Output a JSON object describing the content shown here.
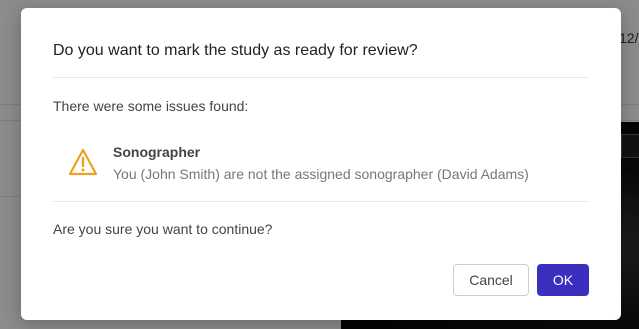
{
  "background": {
    "date_fragment": "12/"
  },
  "dialog": {
    "title": "Do you want to mark the study as ready for review?",
    "issues_heading": "There were some issues found:",
    "issues": [
      {
        "icon": "warning-triangle-icon",
        "title": "Sonographer",
        "description": "You (John Smith) are not the assigned sonographer (David Adams)"
      }
    ],
    "confirm_text": "Are you sure you want to continue?",
    "buttons": {
      "cancel": "Cancel",
      "ok": "OK"
    }
  },
  "colors": {
    "primary": "#3b2fbf",
    "warning": "#f0a020",
    "overlay": "rgba(0,0,0,0.45)"
  }
}
